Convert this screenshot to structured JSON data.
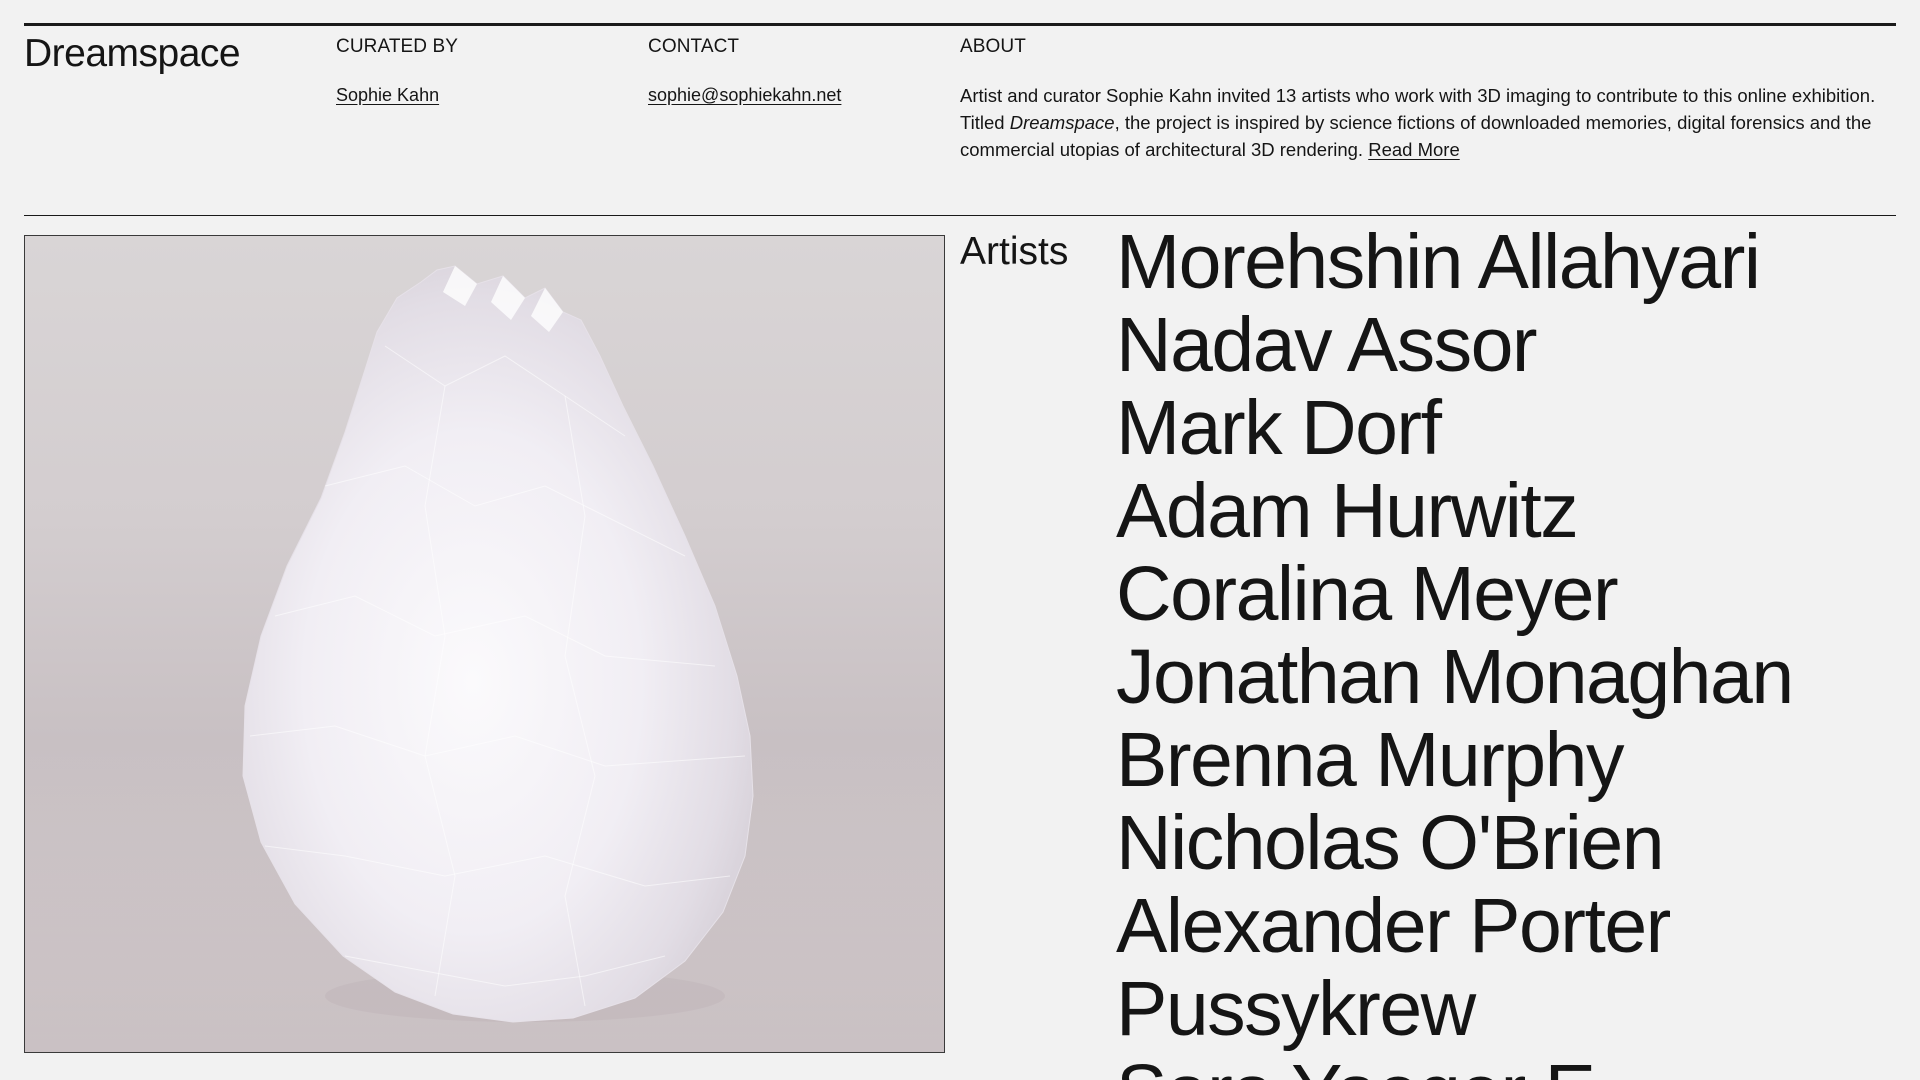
{
  "site": {
    "title": "Dreamspace"
  },
  "header": {
    "curated_by": {
      "heading": "CURATED BY",
      "name": "Sophie Kahn"
    },
    "contact": {
      "heading": "CONTACT",
      "email": "sophie@sophiekahn.net"
    },
    "about": {
      "heading": "ABOUT",
      "text_before": "Artist and curator Sophie Kahn invited 13 artists who work with 3D imaging to contribute to this online exhibition. Titled ",
      "text_italic": "Dreamspace",
      "text_after": ", the project is inspired by science fictions of downloaded memories, digital forensics and the commercial utopias of architectural 3D rendering. ",
      "read_more": "Read More"
    }
  },
  "artists": {
    "label": "Artists",
    "names": [
      "Morehshin Allahyari",
      "Nadav Assor",
      "Mark Dorf",
      "Adam Hurwitz",
      "Coralina Meyer",
      "Jonathan Monaghan",
      "Brenna Murphy",
      "Nicholas O'Brien",
      "Alexander Porter",
      "Pussykrew",
      "Sara Yaeger E..."
    ]
  },
  "colors": {
    "background": "#f2f2f2",
    "text": "#151515",
    "hero_background": "#d3cdcf",
    "sculpture": "#f5f2f6"
  }
}
